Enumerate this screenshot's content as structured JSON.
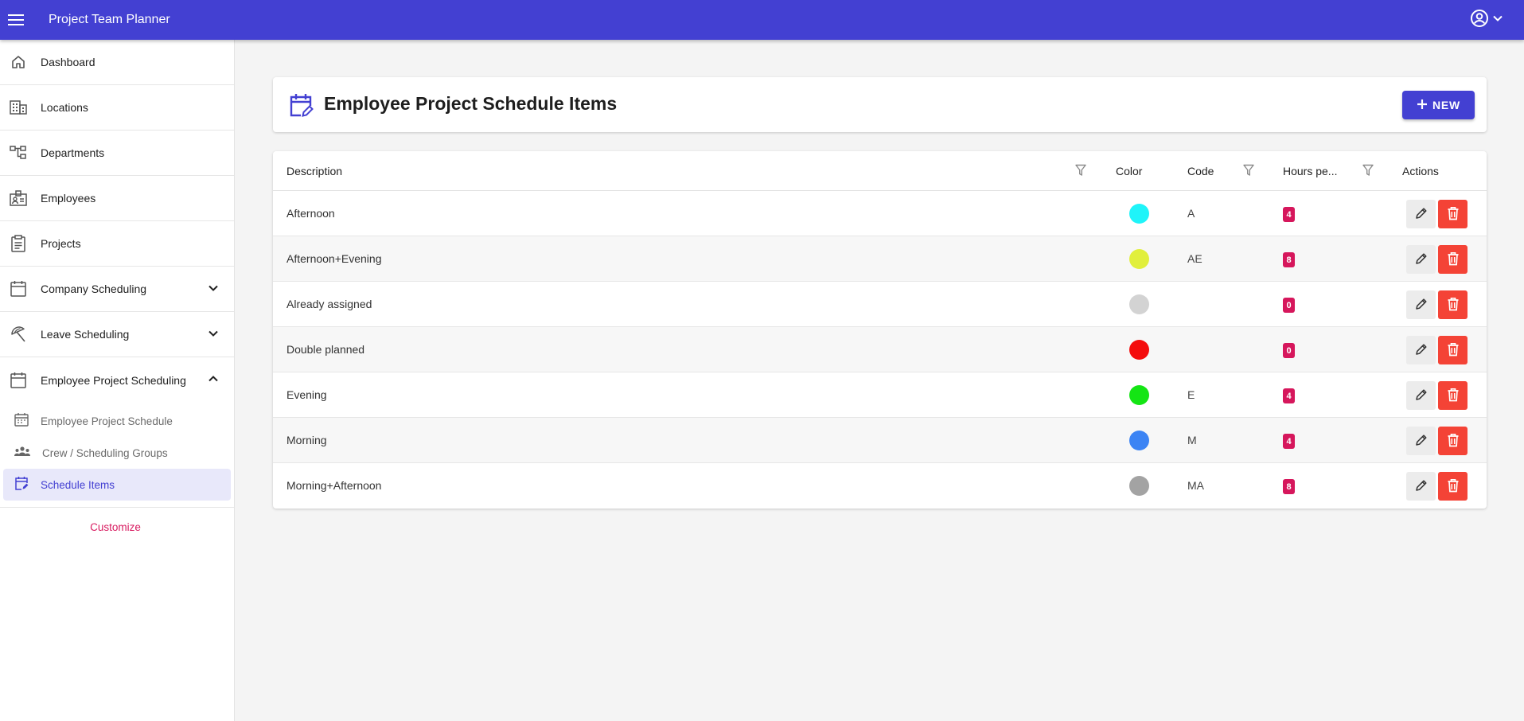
{
  "app": {
    "title": "Project Team Planner"
  },
  "icons": {
    "menu": "hamburger-menu-icon",
    "user": "account-circle-icon",
    "caret": "chevron-down-icon"
  },
  "sidebar": {
    "items": [
      {
        "label": "Dashboard",
        "icon": "home-icon"
      },
      {
        "label": "Locations",
        "icon": "building-icon"
      },
      {
        "label": "Departments",
        "icon": "org-chart-icon"
      },
      {
        "label": "Employees",
        "icon": "badge-icon"
      },
      {
        "label": "Projects",
        "icon": "clipboard-icon"
      },
      {
        "label": "Company Scheduling",
        "icon": "calendar-icon",
        "expand": "collapsed"
      },
      {
        "label": "Leave Scheduling",
        "icon": "beach-umbrella-icon",
        "expand": "collapsed"
      },
      {
        "label": "Employee Project Scheduling",
        "icon": "calendar-icon",
        "expand": "expanded"
      }
    ],
    "sub_items": [
      {
        "label": "Employee Project Schedule",
        "icon": "calendar-small-icon",
        "active": false
      },
      {
        "label": "Crew / Scheduling Groups",
        "icon": "group-icon",
        "active": false
      },
      {
        "label": "Schedule Items",
        "icon": "calendar-edit-icon",
        "active": true
      }
    ],
    "customize_label": "Customize"
  },
  "page": {
    "title": "Employee Project Schedule Items",
    "icon": "calendar-edit-icon",
    "new_button": "NEW"
  },
  "table": {
    "columns": {
      "description": "Description",
      "color": "Color",
      "code": "Code",
      "hours": "Hours pe...",
      "actions": "Actions"
    },
    "rows": [
      {
        "description": "Afternoon",
        "color": "#1ff4f9",
        "code": "A",
        "hours": "4"
      },
      {
        "description": "Afternoon+Evening",
        "color": "#e1ef3c",
        "code": "AE",
        "hours": "8"
      },
      {
        "description": "Already assigned",
        "color": "#d3d3d3",
        "code": "",
        "hours": "0"
      },
      {
        "description": "Double planned",
        "color": "#f40c0c",
        "code": "",
        "hours": "0"
      },
      {
        "description": "Evening",
        "color": "#14e514",
        "code": "E",
        "hours": "4"
      },
      {
        "description": "Morning",
        "color": "#3c84f4",
        "code": "M",
        "hours": "4"
      },
      {
        "description": "Morning+Afternoon",
        "color": "#a3a3a3",
        "code": "MA",
        "hours": "8"
      }
    ]
  },
  "colors": {
    "primary": "#4340d2",
    "danger": "#f44336",
    "badge": "#d6175c",
    "accent_link": "#d81b60"
  }
}
